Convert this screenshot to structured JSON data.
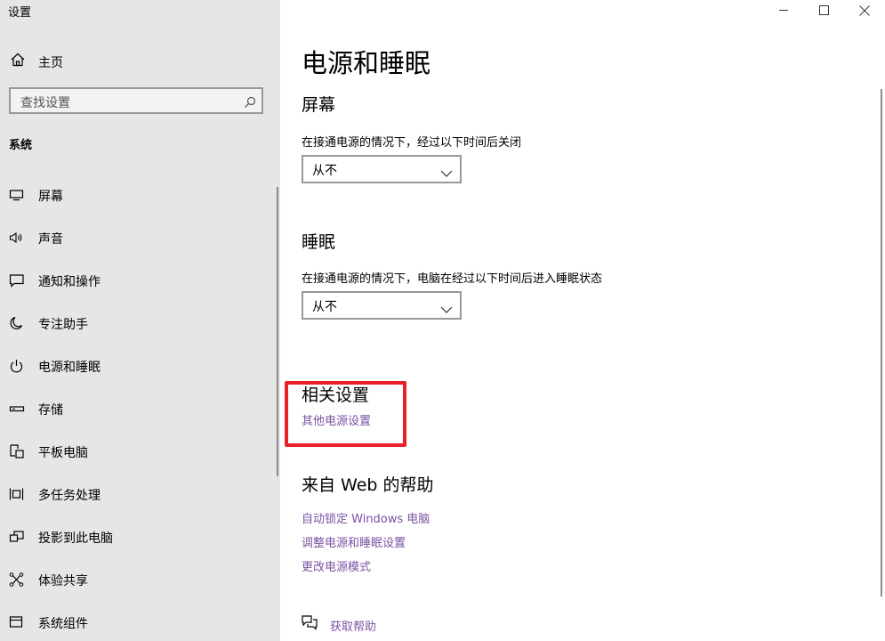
{
  "window": {
    "title": "设置",
    "controls": [
      "minimize-icon",
      "maximize-icon",
      "close-icon"
    ]
  },
  "sidebar": {
    "home_label": "主页",
    "search_placeholder": "查找设置",
    "section_title": "系统",
    "items": [
      {
        "label": "屏幕",
        "icon": "display-icon"
      },
      {
        "label": "声音",
        "icon": "speaker-icon"
      },
      {
        "label": "通知和操作",
        "icon": "notification-icon"
      },
      {
        "label": "专注助手",
        "icon": "moon-icon"
      },
      {
        "label": "电源和睡眠",
        "icon": "power-icon"
      },
      {
        "label": "存储",
        "icon": "storage-icon"
      },
      {
        "label": "平板电脑",
        "icon": "tablet-icon"
      },
      {
        "label": "多任务处理",
        "icon": "multitask-icon"
      },
      {
        "label": "投影到此电脑",
        "icon": "project-icon"
      },
      {
        "label": "体验共享",
        "icon": "share-icon"
      },
      {
        "label": "系统组件",
        "icon": "component-icon"
      }
    ]
  },
  "main": {
    "title": "电源和睡眠",
    "screen": {
      "heading": "屏幕",
      "desc": "在接通电源的情况下，经过以下时间后关闭",
      "value": "从不"
    },
    "sleep": {
      "heading": "睡眠",
      "desc": "在接通电源的情况下，电脑在经过以下时间后进入睡眠状态",
      "value": "从不"
    },
    "related": {
      "heading": "相关设置",
      "link": "其他电源设置"
    },
    "web_help": {
      "heading": "来自 Web 的帮助",
      "links": [
        "自动锁定 Windows 电脑",
        "调整电源和睡眠设置",
        "更改电源模式"
      ]
    },
    "get_help": "获取帮助"
  },
  "colors": {
    "sidebar_bg": "#e6e6e6",
    "link": "#7a52a3",
    "highlight_border": "#e8202a"
  }
}
